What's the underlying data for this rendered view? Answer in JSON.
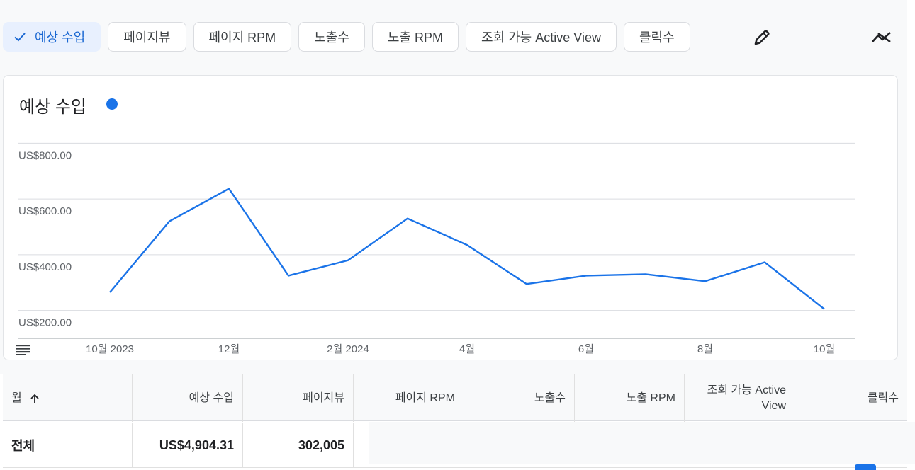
{
  "chips": [
    {
      "label": "예상 수입",
      "selected": true
    },
    {
      "label": "페이지뷰",
      "selected": false
    },
    {
      "label": "페이지 RPM",
      "selected": false
    },
    {
      "label": "노출수",
      "selected": false
    },
    {
      "label": "노출 RPM",
      "selected": false
    },
    {
      "label": "조회 가능 Active View",
      "selected": false
    },
    {
      "label": "클릭수",
      "selected": false
    }
  ],
  "toolbar_icons": {
    "edit": "pencil-icon",
    "trend": "trend-icon"
  },
  "card": {
    "title": "예상 수입",
    "legend_color": "#1a73e8"
  },
  "chart_data": {
    "type": "line",
    "title": "예상 수입",
    "ylim": [
      100,
      900
    ],
    "y_ticks": [
      200,
      400,
      600,
      800
    ],
    "y_tick_labels": [
      "US$200.00",
      "US$400.00",
      "US$600.00",
      "US$800.00"
    ],
    "x_tick_labels": [
      "10월 2023",
      "12월",
      "2월 2024",
      "4월",
      "6월",
      "8월",
      "10월"
    ],
    "x_tick_indices": [
      0,
      2,
      4,
      6,
      8,
      10,
      12
    ],
    "x": [
      "2023-10",
      "2023-11",
      "2023-12",
      "2024-01",
      "2024-02",
      "2024-03",
      "2024-04",
      "2024-05",
      "2024-06",
      "2024-07",
      "2024-08",
      "2024-09",
      "2024-10"
    ],
    "series": [
      {
        "values": [
          265,
          520,
          637,
          325,
          380,
          530,
          435,
          295,
          325,
          330,
          305,
          373,
          205
        ],
        "color": "#1a73e8"
      }
    ],
    "grid": true
  },
  "table": {
    "headers": [
      "월",
      "예상 수입",
      "페이지뷰",
      "페이지 RPM",
      "노출수",
      "노출 RPM",
      "조회 가능 Active View",
      "클릭수"
    ],
    "total_row": [
      "전체",
      "US$4,904.31",
      "302,005"
    ]
  }
}
